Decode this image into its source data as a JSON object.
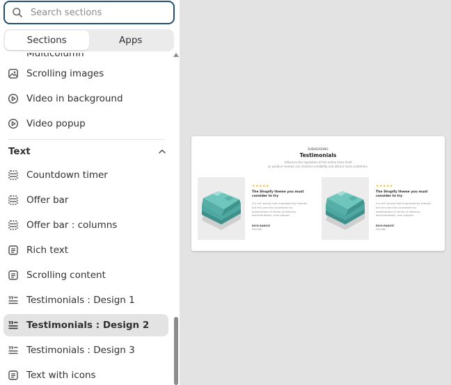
{
  "search": {
    "placeholder": "Search sections"
  },
  "tabs": [
    {
      "label": "Sections",
      "active": true
    },
    {
      "label": "Apps",
      "active": false
    }
  ],
  "sections": {
    "partial_item": "Multicolumn",
    "media_items": [
      {
        "label": "Scrolling images",
        "icon": "image-icon"
      },
      {
        "label": "Video in background",
        "icon": "play-circle-icon"
      },
      {
        "label": "Video popup",
        "icon": "play-circle-icon"
      }
    ],
    "text_category": {
      "title": "Text",
      "items": [
        {
          "label": "Countdown timer",
          "icon": "dashed-layout-icon"
        },
        {
          "label": "Offer bar",
          "icon": "dashed-layout-icon"
        },
        {
          "label": "Offer bar : columns",
          "icon": "dashed-layout-icon"
        },
        {
          "label": "Rich text",
          "icon": "text-block-icon"
        },
        {
          "label": "Scrolling content",
          "icon": "text-block-icon"
        },
        {
          "label": "Testimonials : Design 1",
          "icon": "quote-lines-icon"
        },
        {
          "label": "Testimonials : Design 2",
          "icon": "quote-lines-icon",
          "selected": true
        },
        {
          "label": "Testimonials : Design 3",
          "icon": "quote-lines-icon"
        },
        {
          "label": "Text with icons",
          "icon": "text-block-icon"
        }
      ]
    }
  },
  "preview": {
    "subheading": "Subheading",
    "title": "Testimonials",
    "desc_line1": "Influence the reputation of the online store itself",
    "desc_line2": "as positive reviews can enhance credibility and attract more customers.",
    "colors": {
      "star": "#f2b41e",
      "product_teal": "#5fb8b0"
    },
    "cards": [
      {
        "stars": "★★★★★",
        "title": "The Shopify theme you must consider to try",
        "body": "I'm not usually that impressed by themes but this one has surpassed my expectations in terms of features, documentation, and support.",
        "name": "Rich Radice",
        "role": "Founder"
      },
      {
        "stars": "★★★★★",
        "title": "The Shopify theme you must consider to try",
        "body": "I'm not usually that impressed by themes but this one has surpassed my expectations in terms of features, documentation, and support.",
        "name": "Rich Radice",
        "role": "Founder"
      }
    ]
  }
}
